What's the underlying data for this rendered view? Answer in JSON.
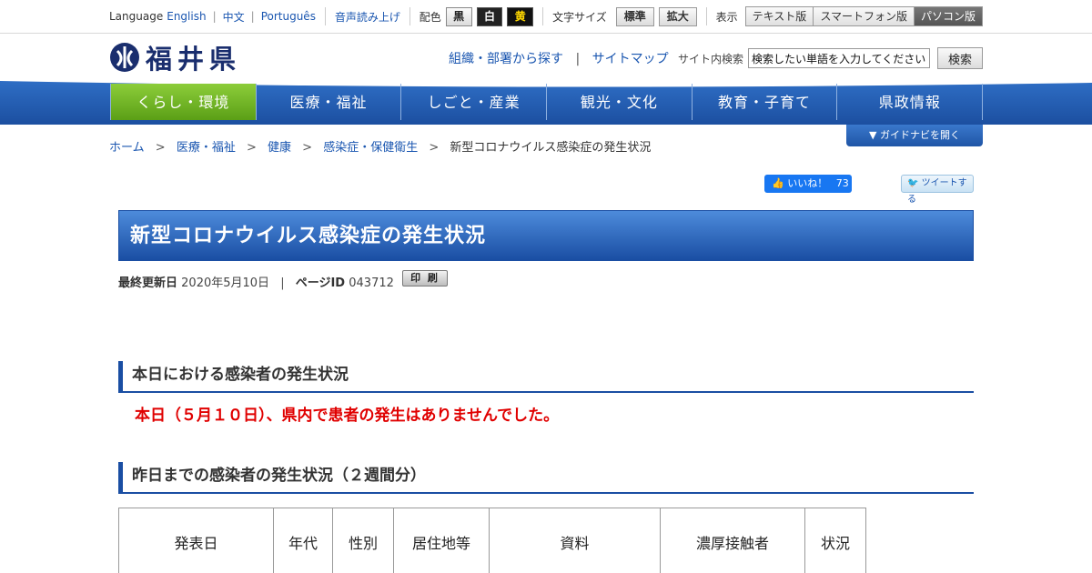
{
  "util": {
    "language_label": "Language",
    "languages": [
      "English",
      "中文",
      "Português"
    ],
    "voice_read": "音声読み上げ",
    "color_label": "配色",
    "color_options": [
      "黒",
      "白",
      "黄"
    ],
    "text_size_label": "文字サイズ",
    "text_size_options": [
      "標準",
      "拡大"
    ],
    "display_label": "表示",
    "display_options": [
      "テキスト版",
      "スマートフォン版",
      "パソコン版"
    ]
  },
  "header": {
    "site_name": "福井県",
    "links": [
      "組織・部署から探す",
      "サイトマップ"
    ],
    "search_label": "サイト内検索",
    "search_value": "検索したい単語を入力してください",
    "search_button": "検索"
  },
  "nav": {
    "items": [
      "くらし・環境",
      "医療・福祉",
      "しごと・産業",
      "観光・文化",
      "教育・子育て",
      "県政情報"
    ],
    "active": "くらし・環境"
  },
  "guide_button": "ガイドナビを開く",
  "breadcrumb": [
    "ホーム",
    "医療・福祉",
    "健康",
    "感染症・保健衛生",
    "新型コロナウイルス感染症の発生状況"
  ],
  "social": {
    "like_label": "いいね！",
    "like_count": "73",
    "tweet_label": "ツイートする"
  },
  "page": {
    "title": "新型コロナウイルス感染症の発生状況",
    "updated_label": "最終更新日",
    "updated_value": "2020年5月10日",
    "page_id_label": "ページID",
    "page_id_value": "043712",
    "print_label": "印 刷"
  },
  "section1": {
    "heading": "本日における感染者の発生状況",
    "notice": "本日（５月１０日）、県内で患者の発生はありませんでした。"
  },
  "section2": {
    "heading": "昨日までの感染者の発生状況（２週間分）",
    "table_headers": [
      "発表日",
      "年代",
      "性別",
      "居住地等",
      "資料",
      "濃厚接触者",
      "状況"
    ]
  },
  "colors": {
    "nav_blue": "#1c4fa0",
    "nav_active_green": "#5b9f16",
    "link_blue": "#1a56b0",
    "alert_red": "#e00000"
  }
}
